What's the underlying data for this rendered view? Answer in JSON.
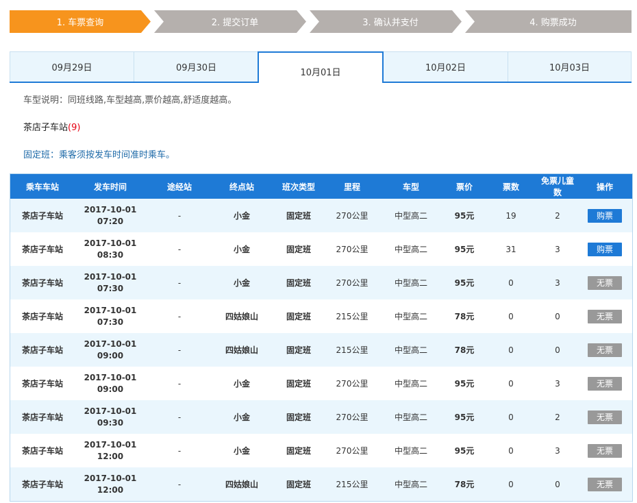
{
  "steps": [
    {
      "label": "1. 车票查询",
      "state": "active"
    },
    {
      "label": "2. 提交订单",
      "state": "inactive"
    },
    {
      "label": "3. 确认并支付",
      "state": "inactive"
    },
    {
      "label": "4. 购票成功",
      "state": "inactive"
    }
  ],
  "colors": {
    "step_active": "#f7941d",
    "step_inactive": "#b5b0ad",
    "primary": "#1e7ad6",
    "row_alt": "#eaf6fd",
    "count_red": "#e60012"
  },
  "date_tabs": [
    {
      "label": "09月29日"
    },
    {
      "label": "09月30日"
    },
    {
      "label": "10月01日",
      "active": true
    },
    {
      "label": "10月02日"
    },
    {
      "label": "10月03日"
    }
  ],
  "notes": {
    "vehicle_type": "车型说明：同班线路,车型越高,票价越高,舒适度越高。",
    "station_name": "茶店子车站",
    "station_count": "(9)",
    "fixed_schedule": "固定班：乘客须按发车时间准时乘车。"
  },
  "table": {
    "headers": [
      "乘车车站",
      "发车时间",
      "途经站",
      "终点站",
      "班次类型",
      "里程",
      "车型",
      "票价",
      "票数",
      "免票儿童数",
      "操作"
    ],
    "rows": [
      {
        "station": "茶店子车站",
        "date": "2017-10-01",
        "time": "07:20",
        "via": "-",
        "dest": "小金",
        "type": "固定班",
        "distance": "270公里",
        "vehicle": "中型高二",
        "price": "95元",
        "tickets": "19",
        "child": "2",
        "action": "购票",
        "available": true
      },
      {
        "station": "茶店子车站",
        "date": "2017-10-01",
        "time": "08:30",
        "via": "-",
        "dest": "小金",
        "type": "固定班",
        "distance": "270公里",
        "vehicle": "中型高二",
        "price": "95元",
        "tickets": "31",
        "child": "3",
        "action": "购票",
        "available": true
      },
      {
        "station": "茶店子车站",
        "date": "2017-10-01",
        "time": "07:30",
        "via": "-",
        "dest": "小金",
        "type": "固定班",
        "distance": "270公里",
        "vehicle": "中型高二",
        "price": "95元",
        "tickets": "0",
        "child": "3",
        "action": "无票",
        "available": false
      },
      {
        "station": "茶店子车站",
        "date": "2017-10-01",
        "time": "07:30",
        "via": "-",
        "dest": "四姑娘山",
        "type": "固定班",
        "distance": "215公里",
        "vehicle": "中型高二",
        "price": "78元",
        "tickets": "0",
        "child": "0",
        "action": "无票",
        "available": false
      },
      {
        "station": "茶店子车站",
        "date": "2017-10-01",
        "time": "09:00",
        "via": "-",
        "dest": "四姑娘山",
        "type": "固定班",
        "distance": "215公里",
        "vehicle": "中型高二",
        "price": "78元",
        "tickets": "0",
        "child": "0",
        "action": "无票",
        "available": false
      },
      {
        "station": "茶店子车站",
        "date": "2017-10-01",
        "time": "09:00",
        "via": "-",
        "dest": "小金",
        "type": "固定班",
        "distance": "270公里",
        "vehicle": "中型高二",
        "price": "95元",
        "tickets": "0",
        "child": "3",
        "action": "无票",
        "available": false
      },
      {
        "station": "茶店子车站",
        "date": "2017-10-01",
        "time": "09:30",
        "via": "-",
        "dest": "小金",
        "type": "固定班",
        "distance": "270公里",
        "vehicle": "中型高二",
        "price": "95元",
        "tickets": "0",
        "child": "2",
        "action": "无票",
        "available": false
      },
      {
        "station": "茶店子车站",
        "date": "2017-10-01",
        "time": "12:00",
        "via": "-",
        "dest": "小金",
        "type": "固定班",
        "distance": "270公里",
        "vehicle": "中型高二",
        "price": "95元",
        "tickets": "0",
        "child": "3",
        "action": "无票",
        "available": false
      },
      {
        "station": "茶店子车站",
        "date": "2017-10-01",
        "time": "12:00",
        "via": "-",
        "dest": "四姑娘山",
        "type": "固定班",
        "distance": "215公里",
        "vehicle": "中型高二",
        "price": "78元",
        "tickets": "0",
        "child": "0",
        "action": "无票",
        "available": false
      }
    ]
  }
}
